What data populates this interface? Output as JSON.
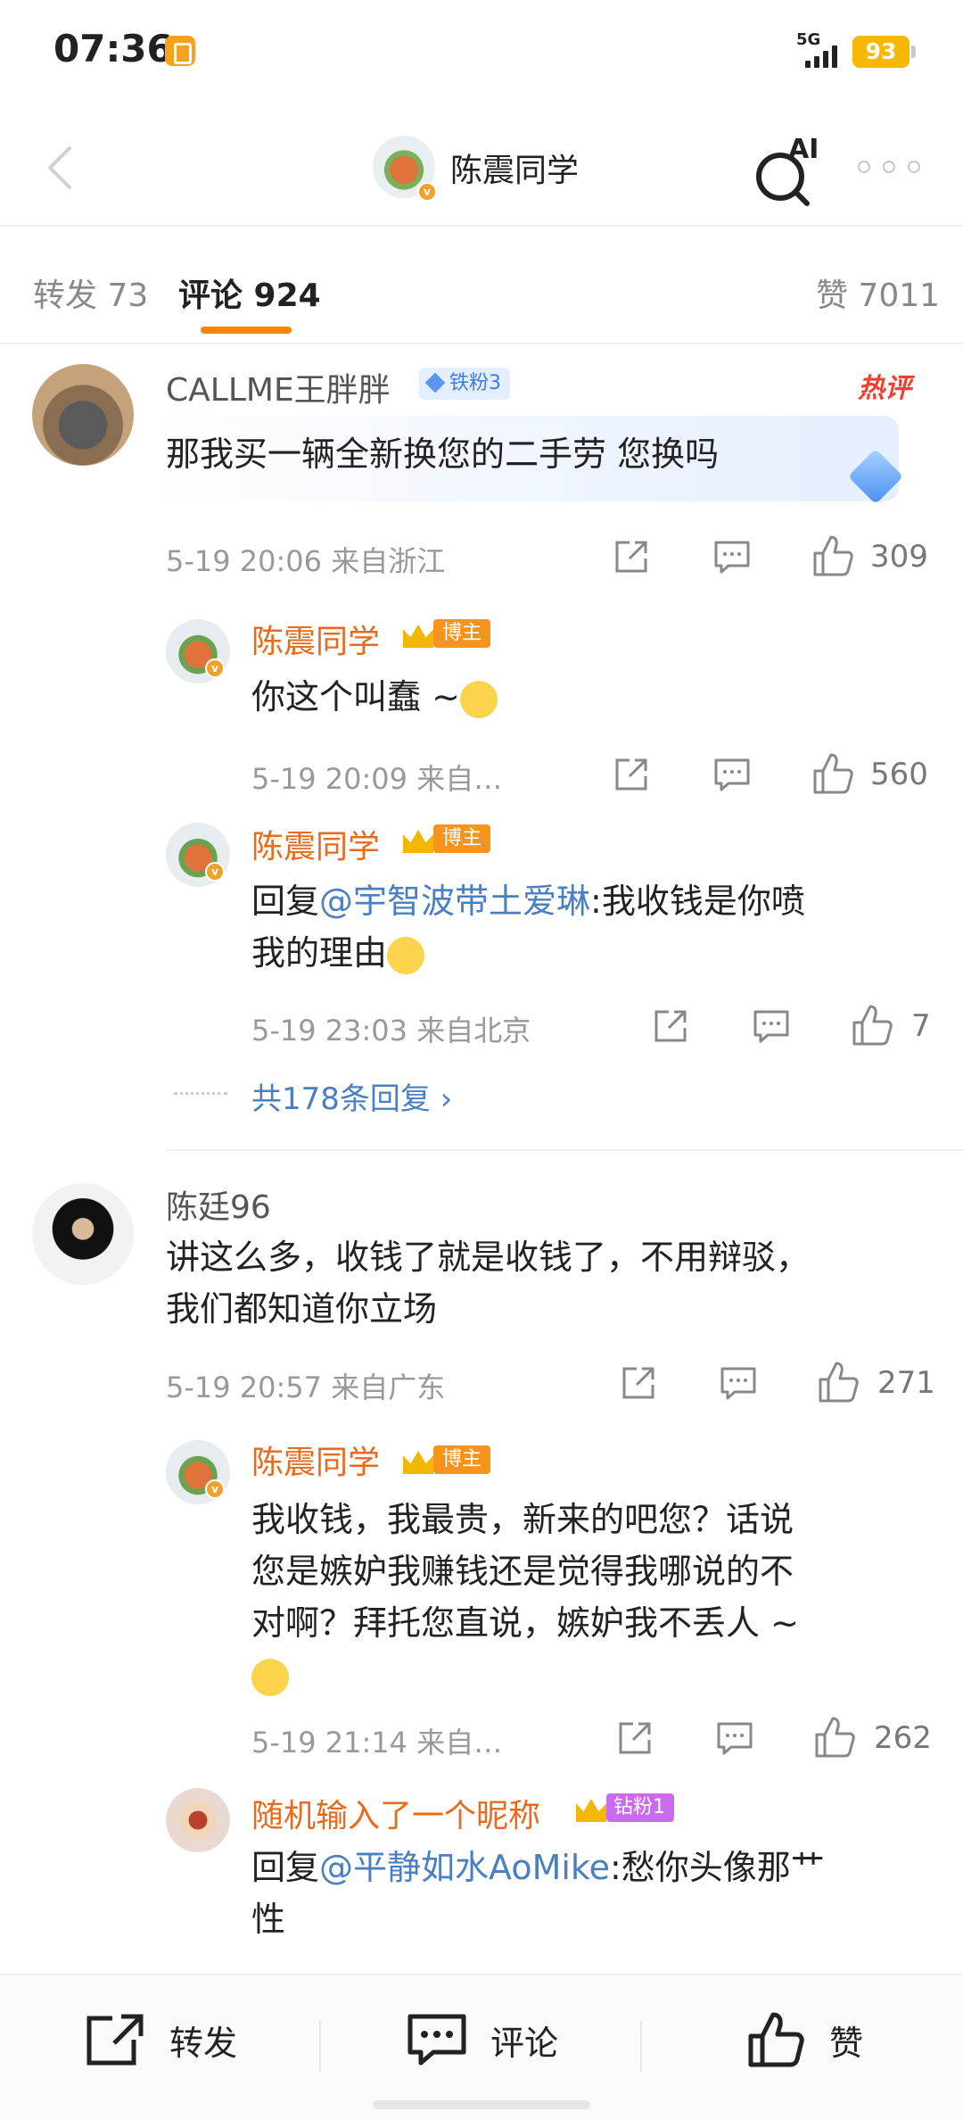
{
  "status_bar": {
    "time": "07:36",
    "network": "5G",
    "battery": "93"
  },
  "nav": {
    "title": "陈震同学",
    "ai_label": "AI"
  },
  "tabs": [
    {
      "label": "转发 73",
      "active": false
    },
    {
      "label": "评论 924",
      "active": true
    },
    {
      "label": "赞 7011",
      "active": false
    }
  ],
  "comments": [
    {
      "username": "CALLME王胖胖",
      "badge": "铁粉3",
      "hot_label": "热评",
      "text": "那我买一辆全新换您的二手劳 您换吗",
      "meta": "5-19 20:06 来自浙江",
      "likes": "309",
      "replies": [
        {
          "username": "陈震同学",
          "badge": "博主",
          "text": "你这个叫蠢 ~",
          "meta": "5-19 20:09 来自…",
          "likes": "560"
        },
        {
          "username": "陈震同学",
          "badge": "博主",
          "text_prefix": "回复",
          "mention": "@宇智波带土爱琳",
          "text_line1_rest": ":我收钱是你喷",
          "text_line2": "我的理由",
          "meta": "5-19 23:03 来自北京",
          "likes": "7"
        }
      ],
      "more_replies": "共178条回复 ›"
    },
    {
      "username": "陈廷96",
      "text_line1": "讲这么多，收钱了就是收钱了，不用辩驳，",
      "text_line2": "我们都知道你立场",
      "meta": "5-19 20:57 来自广东",
      "likes": "271",
      "replies": [
        {
          "username": "陈震同学",
          "badge": "博主",
          "text_line1": "我收钱，我最贵，新来的吧您？话说",
          "text_line2": "您是嫉妒我赚钱还是觉得我哪说的不",
          "text_line3": "对啊？拜托您直说，嫉妒我不丢人 ~",
          "meta": "5-19 21:14 来自…",
          "likes": "262"
        },
        {
          "username": "随机输入了一个昵称",
          "badge": "钻粉1",
          "text_prefix": "回复",
          "mention": "@平静如水AoMike",
          "text_line1_rest": ":愁你头像那艹",
          "text_line2": "性"
        }
      ]
    }
  ],
  "bottom_bar": {
    "repost": "转发",
    "comment": "评论",
    "like": "赞"
  },
  "colors": {
    "accent": "#ff8200",
    "link": "#4a7fc1",
    "blogger_name": "#e86a1c"
  }
}
